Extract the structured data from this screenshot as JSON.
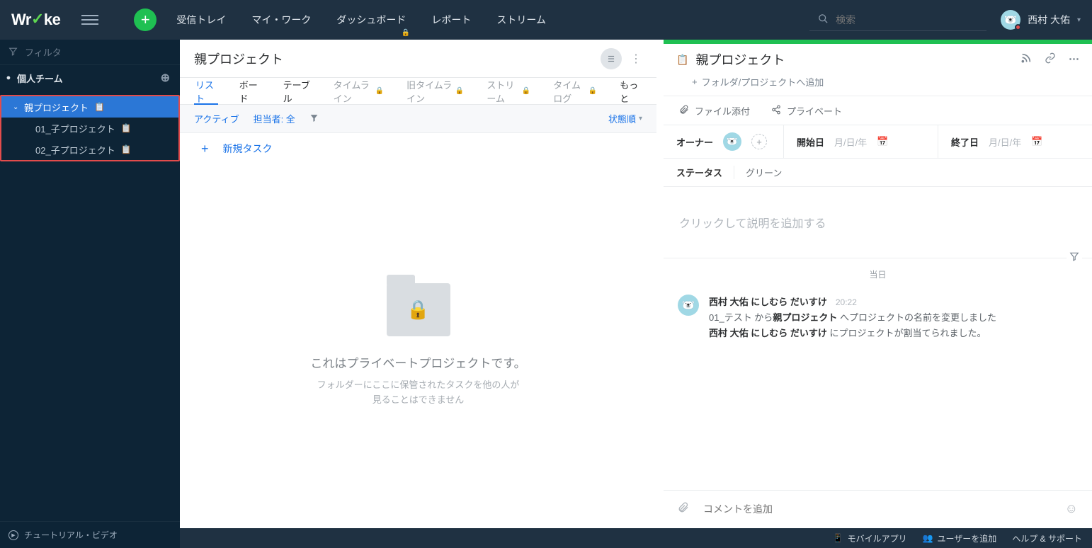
{
  "brand": {
    "pre": "Wr",
    "post": "ke"
  },
  "nav": {
    "items": [
      "受信トレイ",
      "マイ・ワーク",
      "ダッシュボード",
      "レポート",
      "ストリーム"
    ],
    "search_ph": "検索"
  },
  "user": {
    "name": "西村 大佑"
  },
  "sidebar": {
    "filter": "フィルタ",
    "team": "個人チーム",
    "items": [
      {
        "label": "親プロジェクト"
      },
      {
        "label": "01_子プロジェクト"
      },
      {
        "label": "02_子プロジェクト"
      }
    ],
    "tutorial": "チュートリアル・ビデオ"
  },
  "center": {
    "title": "親プロジェクト",
    "tabs": [
      "リスト",
      "ボード",
      "テーブル",
      "タイムライン",
      "旧タイムライン",
      "ストリーム",
      "タイムログ",
      "もっと"
    ],
    "filter_active": "アクティブ",
    "filter_assignee": "担当者: 全",
    "sort": "状態順",
    "new_task": "新規タスク",
    "empty_title": "これはプライベートプロジェクトです。",
    "empty_sub1": "フォルダーにここに保管されたタスクを他の人が",
    "empty_sub2": "見ることはできません"
  },
  "right": {
    "title": "親プロジェクト",
    "add_folder": "フォルダ/プロジェクトへ追加",
    "attach": "ファイル添付",
    "private": "プライベート",
    "owner_label": "オーナー",
    "start_label": "開始日",
    "end_label": "終了日",
    "date_ph": "月/日/年",
    "status_label": "ステータス",
    "status_val": "グリーン",
    "desc_ph": "クリックして説明を追加する",
    "activity_date": "当日",
    "activity_name": "西村 大佑 にしむら だいすけ",
    "activity_time": "20:22",
    "line1_pre": "01_テスト から",
    "line1_bold": "親プロジェクト",
    "line1_post": " へプロジェクトの名前を変更しました",
    "line2_a": "西村 大佑 にしむら だいすけ",
    "line2_b": " にプロジェクトが割当てられました。",
    "comment_ph": "コメントを追加"
  },
  "bottom": {
    "mobile": "モバイルアプリ",
    "adduser": "ユーザーを追加",
    "help": "ヘルプ & サポート"
  }
}
